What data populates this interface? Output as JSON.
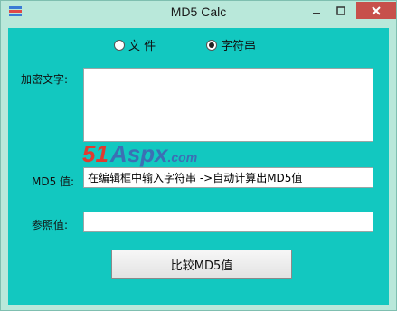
{
  "window": {
    "title": "MD5 Calc",
    "title_color": "#1a1a1a",
    "close_color": "#c7504b",
    "client_color": "#12c8c0"
  },
  "mode": {
    "options": [
      {
        "label": "文 件",
        "selected": false
      },
      {
        "label": "字符串",
        "selected": true
      }
    ]
  },
  "form": {
    "plaintext_label": "加密文字:",
    "plaintext_value": "",
    "md5_label": "MD5 值:",
    "md5_value": "在编辑框中输入字符串 ->自动计算出MD5值",
    "reference_label": "参照值:",
    "reference_value": "",
    "compare_button_label": "比较MD5值"
  },
  "watermark": {
    "number": "51",
    "name": "Aspx",
    "domain": ".com"
  }
}
